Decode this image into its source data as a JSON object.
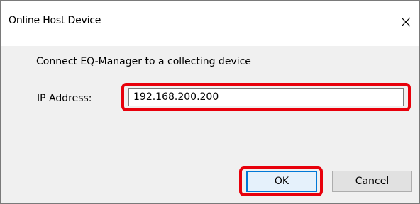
{
  "dialog": {
    "title": "Online Host Device",
    "close_icon": "close-icon",
    "prompt": "Connect EQ-Manager to a collecting device",
    "ip_label": "IP Address:",
    "ip_value": "192.168.200.200",
    "ok_label": "OK",
    "cancel_label": "Cancel"
  },
  "colors": {
    "highlight": "#e8000b",
    "focus_border": "#0078d7",
    "dialog_bg": "#f0f0f0",
    "titlebar_bg": "#ffffff"
  }
}
